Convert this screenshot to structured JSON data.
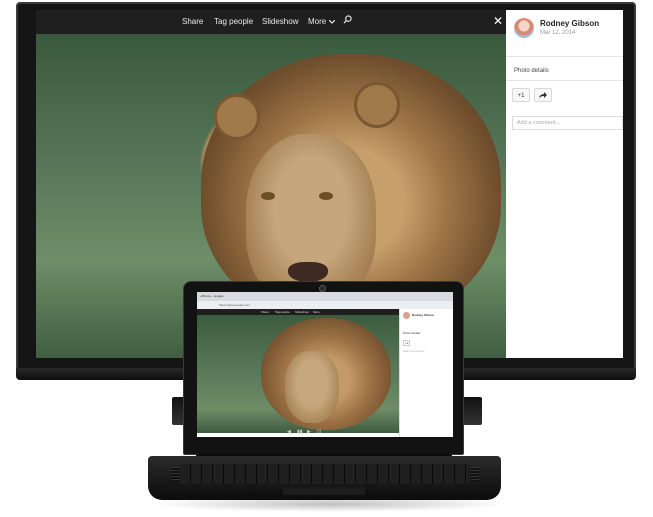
{
  "monitor": {
    "menu": {
      "share": "Share",
      "tag_people": "Tag people",
      "slideshow": "Slideshow",
      "more": "More",
      "more_icon": "chevron-down-icon",
      "search_icon": "search-icon",
      "close": "✕"
    },
    "panel": {
      "user_name": "Rodney Gibson",
      "date": "Mar 12, 2014",
      "photo_details": "Photo details",
      "plus_one": "+1",
      "share_icon": "share-icon",
      "comment_placeholder": "Add a comment..."
    }
  },
  "laptop": {
    "tab_title": "+Photos - Google",
    "url": "https://plus.google.com",
    "menu": [
      "Share",
      "Tag people",
      "Slideshow",
      "More",
      ""
    ],
    "panel": {
      "user_name": "Rodney Gibson",
      "photo_details": "Photo details",
      "plus_one": "+1",
      "comment_placeholder": "Add a comment..."
    },
    "taskbar": [
      "◀",
      "▮▮",
      "▶",
      "⊡"
    ]
  },
  "colors": {
    "screen_bg": "#1d1d1d",
    "panel_bg": "#ffffff",
    "menu_text": "#e8e8e8"
  }
}
